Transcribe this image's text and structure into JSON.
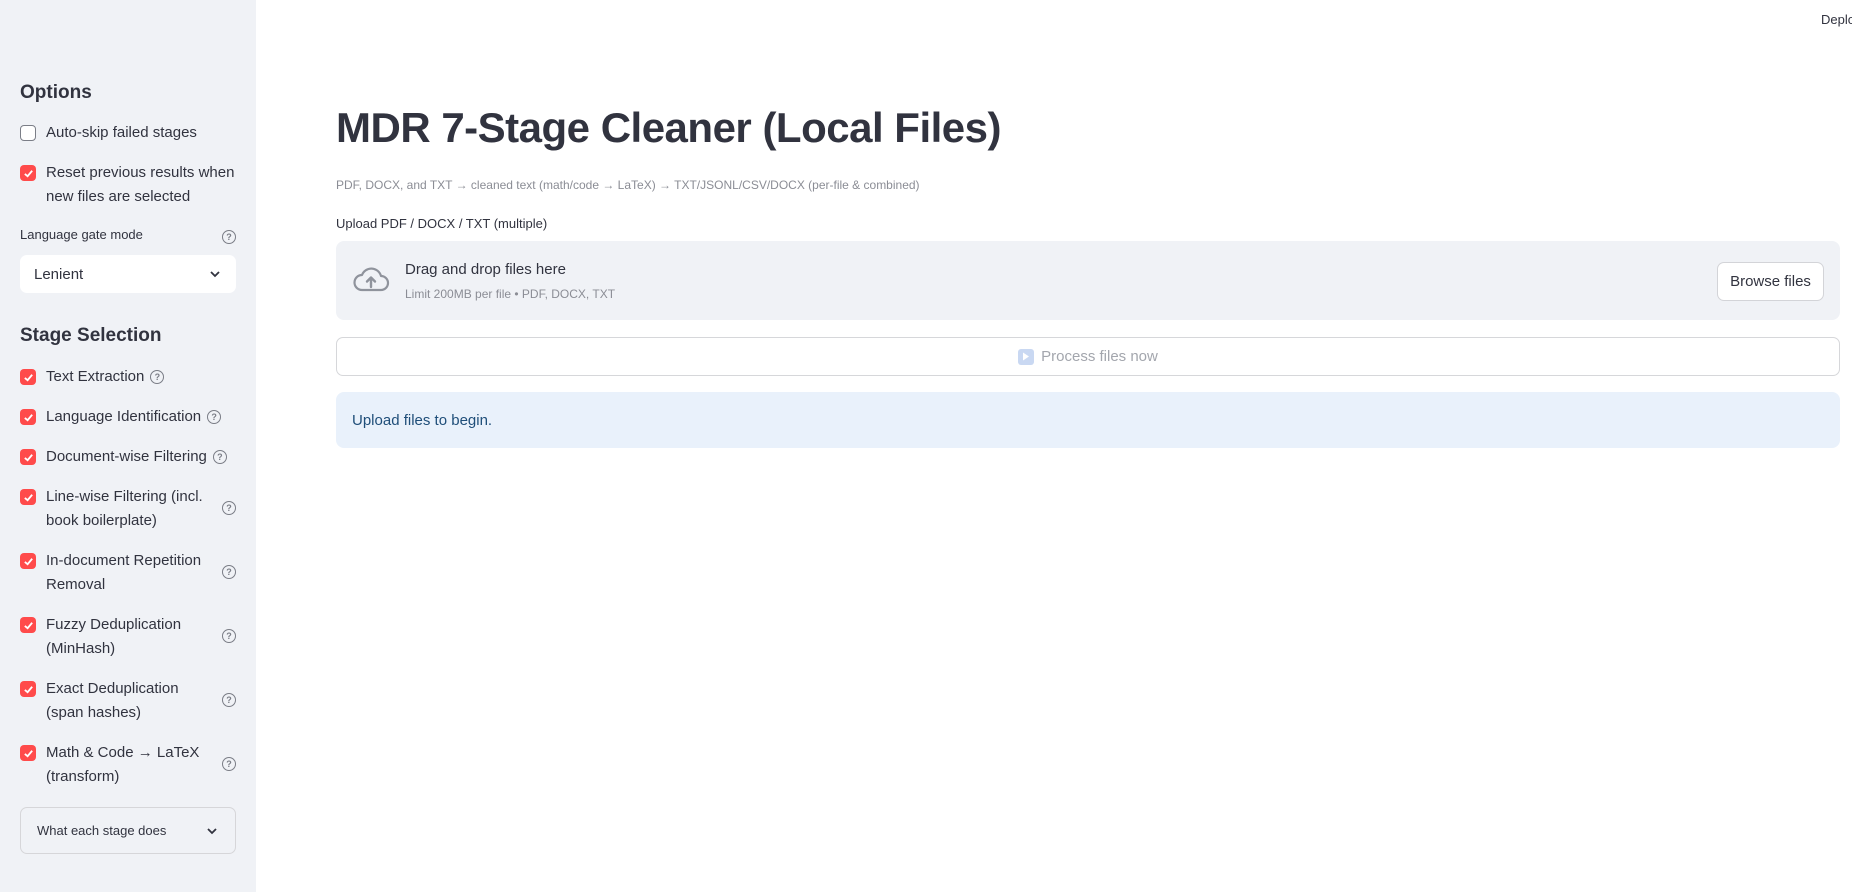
{
  "sidebar": {
    "options_heading": "Options",
    "options": [
      {
        "label": "Auto-skip failed stages",
        "checked": false
      },
      {
        "label": "Reset previous results when new files are selected",
        "checked": true
      }
    ],
    "language_gate": {
      "label": "Language gate mode",
      "value": "Lenient"
    },
    "stage_heading": "Stage Selection",
    "stages": [
      {
        "label": "Text Extraction",
        "checked": true
      },
      {
        "label": "Language Identification",
        "checked": true
      },
      {
        "label": "Document-wise Filtering",
        "checked": true
      },
      {
        "label": "Line-wise Filtering (incl. book boilerplate)",
        "checked": true
      },
      {
        "label": "In-document Repetition Removal",
        "checked": true
      },
      {
        "label": "Fuzzy Deduplication (MinHash)",
        "checked": true
      },
      {
        "label": "Exact Deduplication (span hashes)",
        "checked": true
      },
      {
        "label": "Math & Code → LaTeX (transform)",
        "checked": true
      }
    ],
    "expander_label": "What each stage does"
  },
  "header": {
    "deploy_label": "Deplo"
  },
  "main": {
    "title": "MDR 7-Stage Cleaner (Local Files)",
    "caption": "PDF, DOCX, and TXT → cleaned text (math/code → LaTeX) → TXT/JSONL/CSV/DOCX (per-file & combined)",
    "uploader": {
      "label": "Upload PDF / DOCX / TXT (multiple)",
      "drop_title": "Drag and drop files here",
      "drop_sub": "Limit 200MB per file • PDF, DOCX, TXT",
      "browse_label": "Browse files"
    },
    "process_label": "Process files now",
    "info_text": "Upload files to begin."
  },
  "colors": {
    "accent": "#ff4b4b",
    "sidebar_bg": "#f0f2f6",
    "info_bg": "#e9f1fb"
  }
}
